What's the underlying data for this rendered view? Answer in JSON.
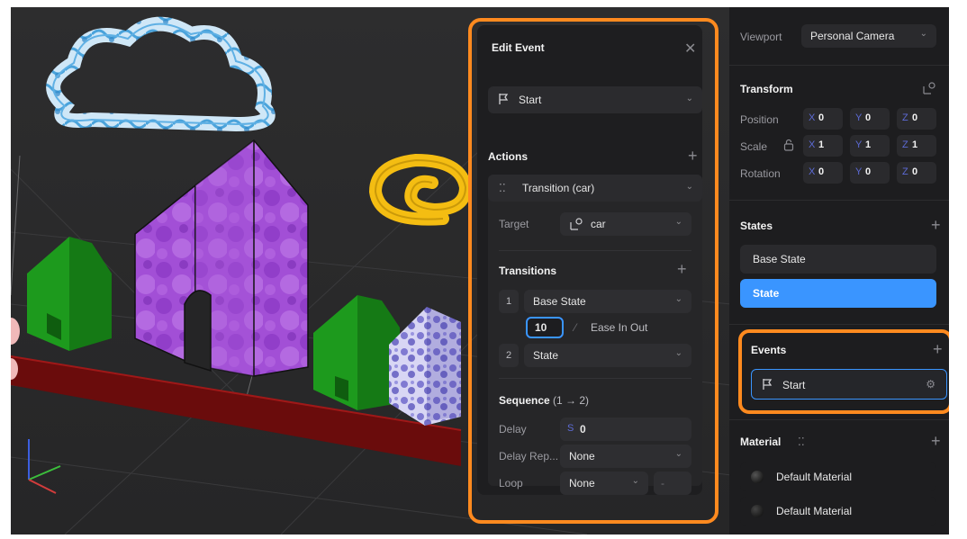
{
  "edit_event": {
    "title": "Edit Event",
    "close_icon": "close-icon",
    "trigger": {
      "icon": "flag-icon",
      "value": "Start"
    },
    "actions": {
      "heading": "Actions",
      "transition_action": {
        "icon": "transition-icon",
        "label": "Transition (car)"
      },
      "target_label": "Target",
      "target_value": "car",
      "transitions_heading": "Transitions",
      "steps": [
        {
          "index": "1",
          "state": "Base State"
        },
        {
          "index": "2",
          "state": "State"
        }
      ],
      "duration": "10",
      "easing": "Ease In Out",
      "sequence_heading": "Sequence",
      "sequence_range": "(1 → 2)",
      "delay_label": "Delay",
      "delay_unit": "S",
      "delay_value": "0",
      "delay_repeat_label": "Delay Rep...",
      "delay_repeat_value": "None",
      "loop_label": "Loop",
      "loop_value": "None",
      "loop_extra": "-"
    }
  },
  "inspector": {
    "viewport_label": "Viewport",
    "viewport_value": "Personal Camera",
    "transform_heading": "Transform",
    "position_label": "Position",
    "scale_label": "Scale",
    "rotation_label": "Rotation",
    "position": {
      "x": "0",
      "y": "0",
      "z": "0"
    },
    "scale": {
      "x": "1",
      "y": "1",
      "z": "1"
    },
    "rotation": {
      "x": "0",
      "y": "0",
      "z": "0"
    },
    "axis_labels": {
      "x": "X",
      "y": "Y",
      "z": "Z"
    },
    "states_heading": "States",
    "states": [
      "Base State",
      "State"
    ],
    "events_heading": "Events",
    "event_item": "Start",
    "material_heading": "Material",
    "materials": [
      "Default Material",
      "Default Material"
    ]
  },
  "colors": {
    "accent_blue": "#3a95ff",
    "highlight_orange": "#ff8a1f",
    "house_purple": "#9b3fcf",
    "house_green": "#1e9a1e",
    "swirl_yellow": "#f4bd12"
  }
}
